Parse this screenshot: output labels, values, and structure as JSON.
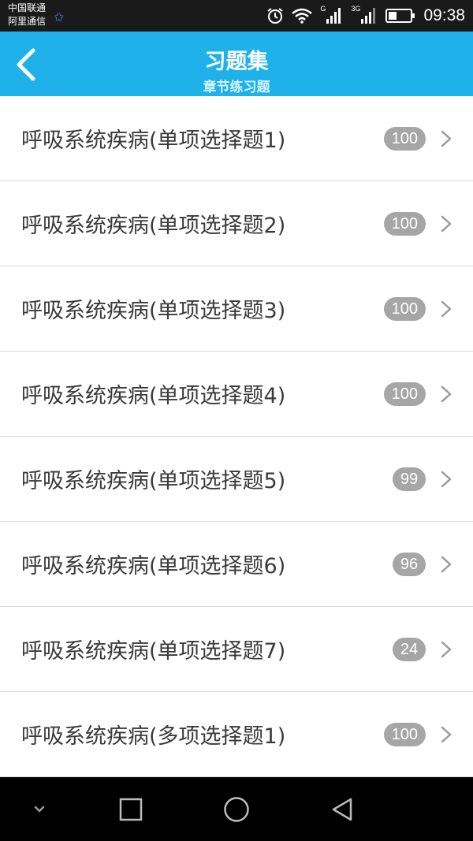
{
  "status_bar": {
    "carrier_primary": "中国联通",
    "carrier_secondary": "阿里通信",
    "network_tag_1": "G",
    "network_tag_2": "3G",
    "time": "09:38",
    "battery_level": 0.4,
    "icons": [
      "star-icon",
      "alarm-icon",
      "wifi-icon",
      "signal-icon",
      "signal-icon",
      "battery-icon"
    ]
  },
  "header": {
    "title": "习题集",
    "subtitle": "章节练习题",
    "back_icon": "chevron-left-icon",
    "color": "#1fb1ea"
  },
  "list": {
    "items": [
      {
        "label": "呼吸系统疾病(单项选择题1)",
        "count": "100"
      },
      {
        "label": "呼吸系统疾病(单项选择题2)",
        "count": "100"
      },
      {
        "label": "呼吸系统疾病(单项选择题3)",
        "count": "100"
      },
      {
        "label": "呼吸系统疾病(单项选择题4)",
        "count": "100"
      },
      {
        "label": "呼吸系统疾病(单项选择题5)",
        "count": "99"
      },
      {
        "label": "呼吸系统疾病(单项选择题6)",
        "count": "96"
      },
      {
        "label": "呼吸系统疾病(单项选择题7)",
        "count": "24"
      },
      {
        "label": "呼吸系统疾病(多项选择题1)",
        "count": "100"
      }
    ],
    "badge_color": "#a6a6a6",
    "chevron_icon": "chevron-right-icon"
  },
  "nav_bar": {
    "icons": [
      "chevron-down-icon",
      "square-icon",
      "circle-icon",
      "triangle-back-icon"
    ]
  }
}
